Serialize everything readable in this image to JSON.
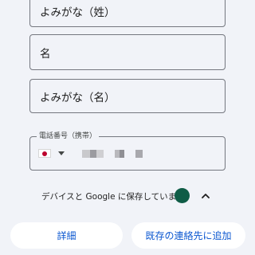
{
  "form": {
    "yomigana_sei": {
      "placeholder": "よみがな（姓）"
    },
    "mei": {
      "placeholder": "名"
    },
    "yomigana_mei": {
      "placeholder": "よみがな（名）"
    },
    "phone": {
      "label": "電話番号（携帯）",
      "country_flag_icon": "japan-flag-icon",
      "value_masked": true
    }
  },
  "sync": {
    "text": "デバイスと Google に保存しています",
    "avatar_color": "#0f5c46",
    "toggle_icon": "chevron-up-icon"
  },
  "actions": {
    "details_label": "詳細",
    "add_to_existing_label": "既存の連絡先に追加"
  },
  "colors": {
    "background": "#f1f3f8",
    "accent": "#0b57d0",
    "outline": "#74777f"
  }
}
